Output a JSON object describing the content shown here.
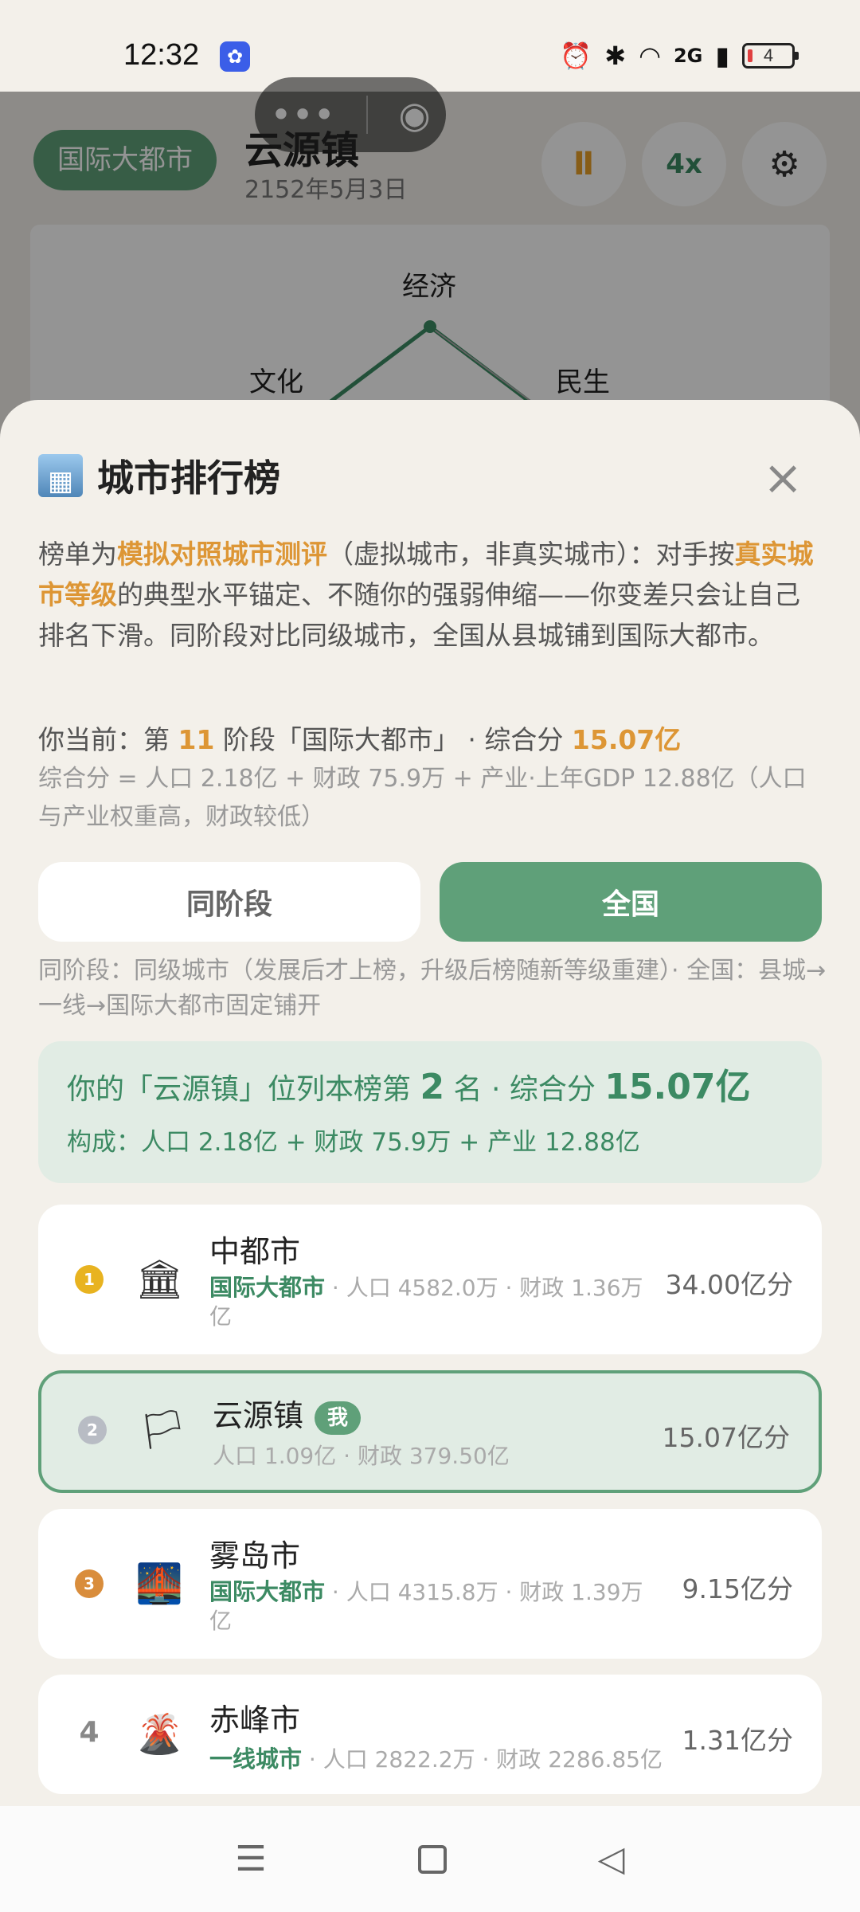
{
  "status_bar": {
    "time": "12:32",
    "app_icon": "app-notification-icon",
    "battery": "4",
    "network": "2G"
  },
  "background": {
    "tier": "国际大都市",
    "city_name": "云源镇",
    "date": "2152年5月3日",
    "pause_icon": "Ⅱ",
    "speed": "4x",
    "radar_axes": [
      "经济",
      "文化",
      "民生"
    ]
  },
  "sheet": {
    "title_emoji": "🏙",
    "title": "城市排行榜",
    "close_icon": "×",
    "intro": {
      "p1": "榜单为",
      "h1": "模拟对照城市测评",
      "p2": "（虚拟城市，非真实城市）：对手按",
      "h2": "真实城市等级",
      "p3": "的典型水平锚定、不随你的强弱伸缩——你变差只会让自己排名下滑。同阶段对比同级城市，全国从县城铺到国际大都市。"
    },
    "current": {
      "prefix": "你当前：第 ",
      "stage": "11",
      "mid": " 阶段「国际大都市」 · 综合分 ",
      "score": "15.07亿"
    },
    "formula": "综合分 = 人口 2.18亿 + 财政 75.9万 + 产业·上年GDP 12.88亿（人口与产业权重高，财政较低）",
    "tabs": {
      "same_stage": "同阶段",
      "national": "全国"
    },
    "tab_note": "同阶段：同级城市（发展后才上榜，升级后榜随新等级重建）· 全国：县城→一线→国际大都市固定铺开",
    "summary": {
      "prefix": "你的「云源镇」位列本榜第 ",
      "rank": "2",
      "mid": " 名 · 综合分 ",
      "score": "15.07亿",
      "composition": "构成：人口 2.18亿 + 财政 75.9万 + 产业 12.88亿"
    },
    "rankings": [
      {
        "rank": "1",
        "icon": "🏛",
        "name": "中都市",
        "tier": "国际大都市",
        "meta": " · 人口 4582.0万 · 财政 1.36万亿",
        "score": "34.00亿分"
      },
      {
        "rank": "2",
        "icon": "🏳",
        "name": "云源镇",
        "badge": "我",
        "meta": "人口 1.09亿 · 财政 379.50亿",
        "score": "15.07亿分"
      },
      {
        "rank": "3",
        "icon": "🌉",
        "name": "雾岛市",
        "tier": "国际大都市",
        "meta": " · 人口 4315.8万 · 财政 1.39万亿",
        "score": "9.15亿分"
      },
      {
        "rank": "4",
        "icon": "🌋",
        "name": "赤峰市",
        "tier": "一线城市",
        "meta": " · 人口 2822.2万 · 财政 2286.85亿",
        "score": "1.31亿分"
      }
    ]
  },
  "navbar": {
    "menu_icon": "☰",
    "back_icon": "◁"
  }
}
